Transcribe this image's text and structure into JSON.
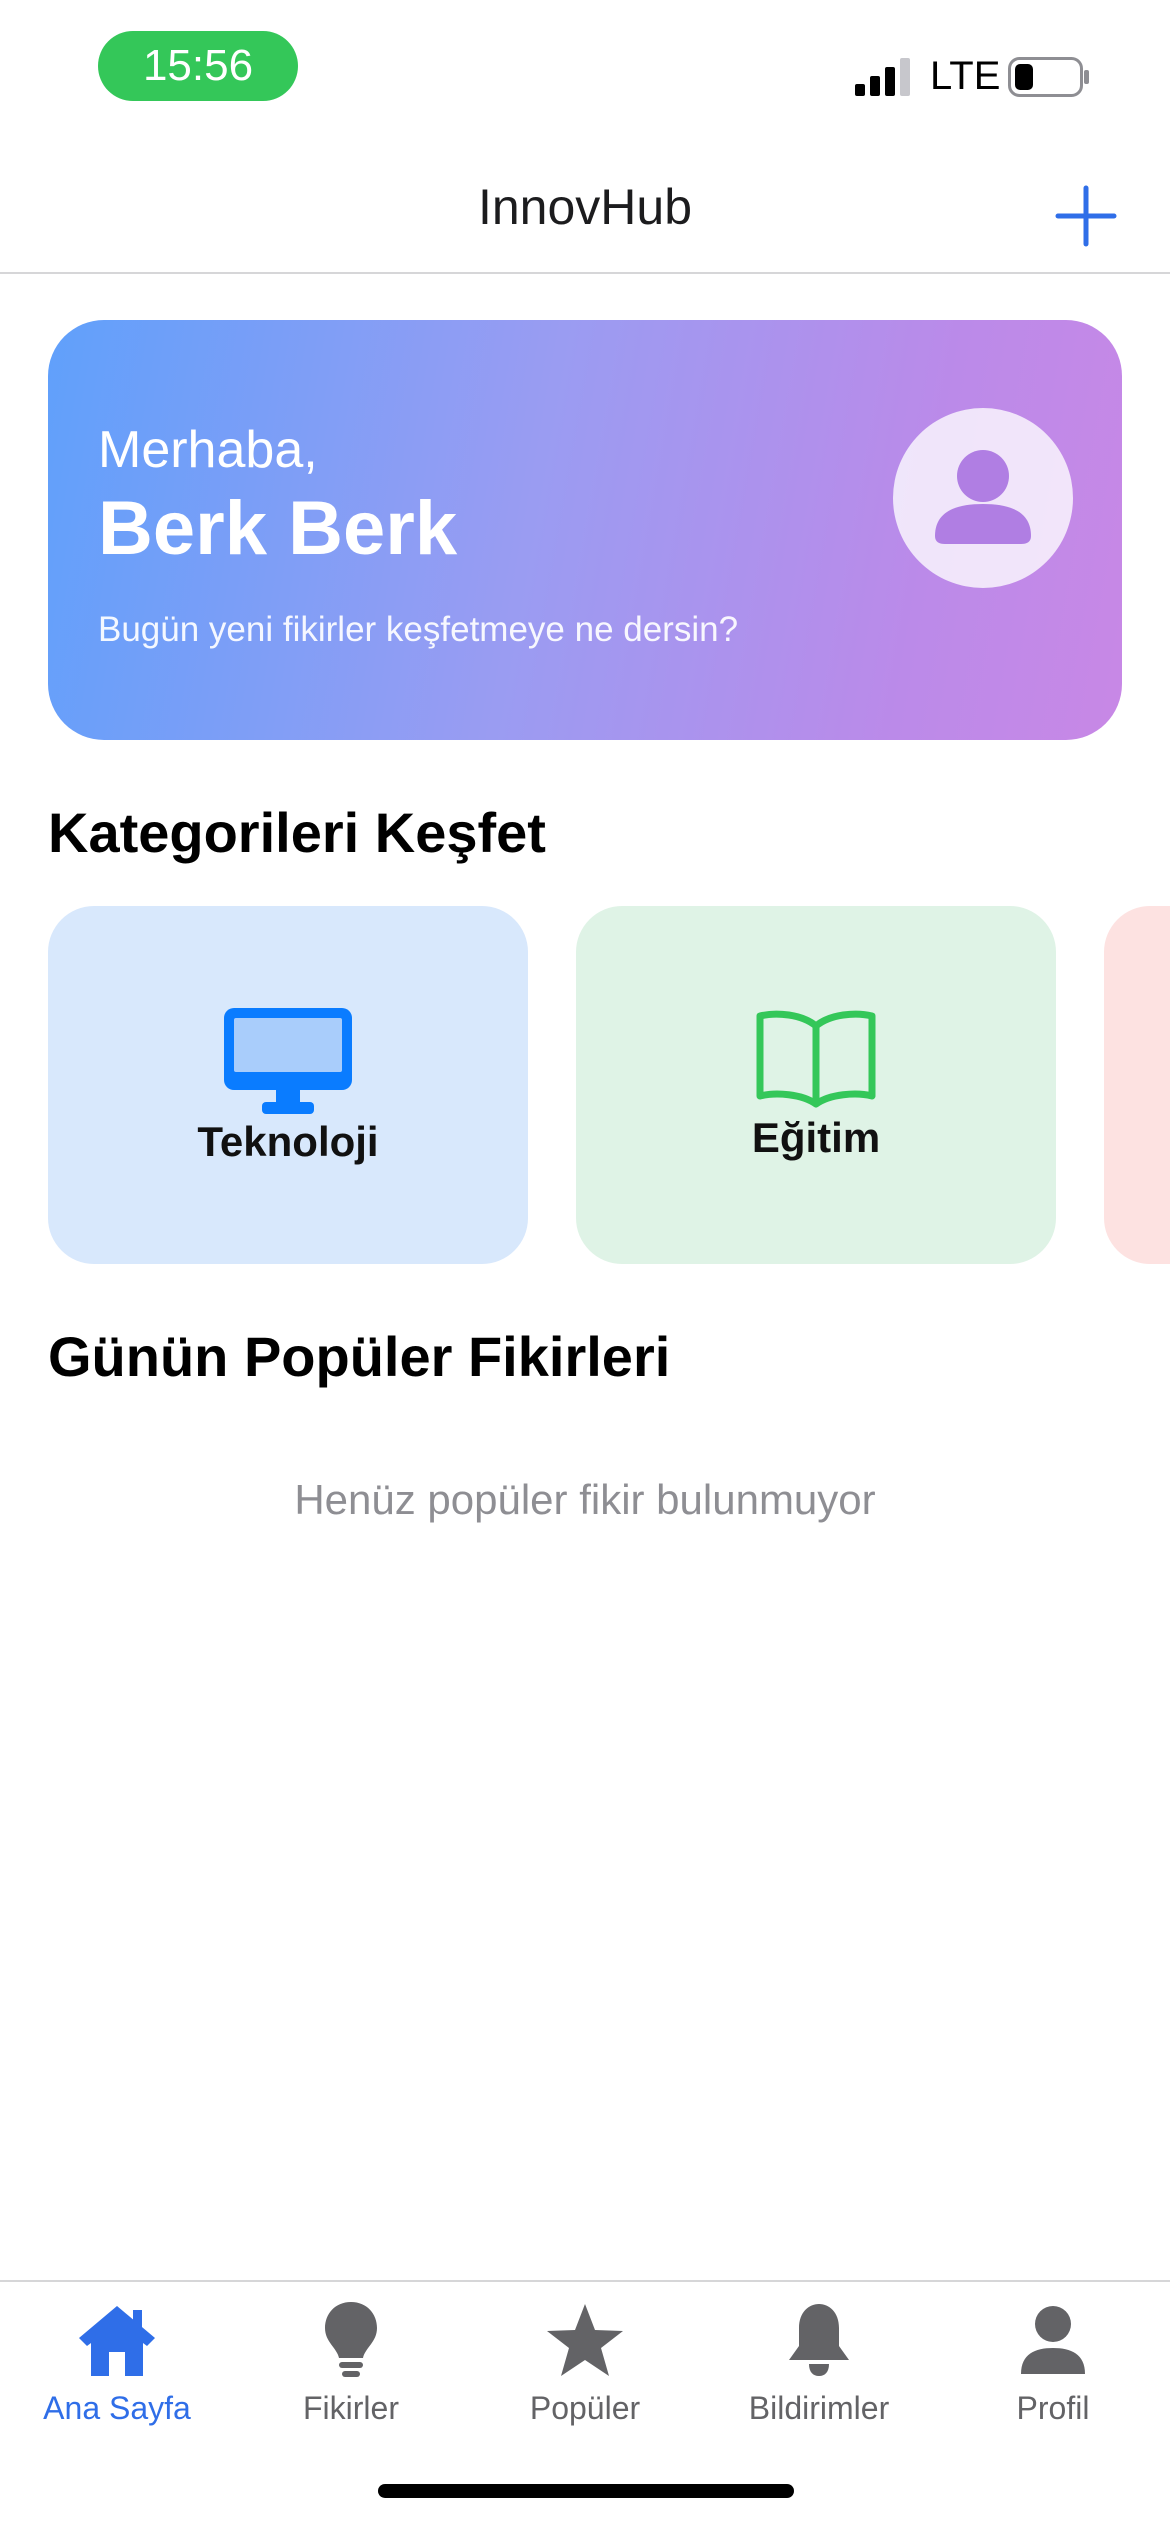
{
  "status_bar": {
    "time": "15:56",
    "carrier": "LTE"
  },
  "nav": {
    "title": "InnovHub",
    "add_icon": "plus-icon"
  },
  "greeting": {
    "hello": "Merhaba,",
    "name": "Berk Berk",
    "subtitle": "Bugün yeni fikirler keşfetmeye ne dersin?",
    "avatar_icon": "person-icon"
  },
  "categories": {
    "title": "Kategorileri Keşfet",
    "items": [
      {
        "label": "Teknoloji",
        "icon": "desktop-icon",
        "color": "#007aff",
        "background": "#d8e8fc"
      },
      {
        "label": "Eğitim",
        "icon": "book-icon",
        "color": "#34c759",
        "background": "#dff3e6"
      },
      {
        "label": "",
        "icon": "",
        "color": "#ff3b30",
        "background": "#fde2e1"
      }
    ]
  },
  "popular": {
    "title": "Günün Popüler Fikirleri",
    "empty_text": "Henüz popüler fikir bulunmuyor"
  },
  "tab_bar": {
    "items": [
      {
        "label": "Ana Sayfa",
        "icon": "house-icon",
        "active": true
      },
      {
        "label": "Fikirler",
        "icon": "lightbulb-icon",
        "active": false
      },
      {
        "label": "Popüler",
        "icon": "star-icon",
        "active": false
      },
      {
        "label": "Bildirimler",
        "icon": "bell-icon",
        "active": false
      },
      {
        "label": "Profil",
        "icon": "person-icon",
        "active": false
      }
    ]
  },
  "colors": {
    "accent": "#2f6ee8",
    "status_pill": "#34c759"
  }
}
